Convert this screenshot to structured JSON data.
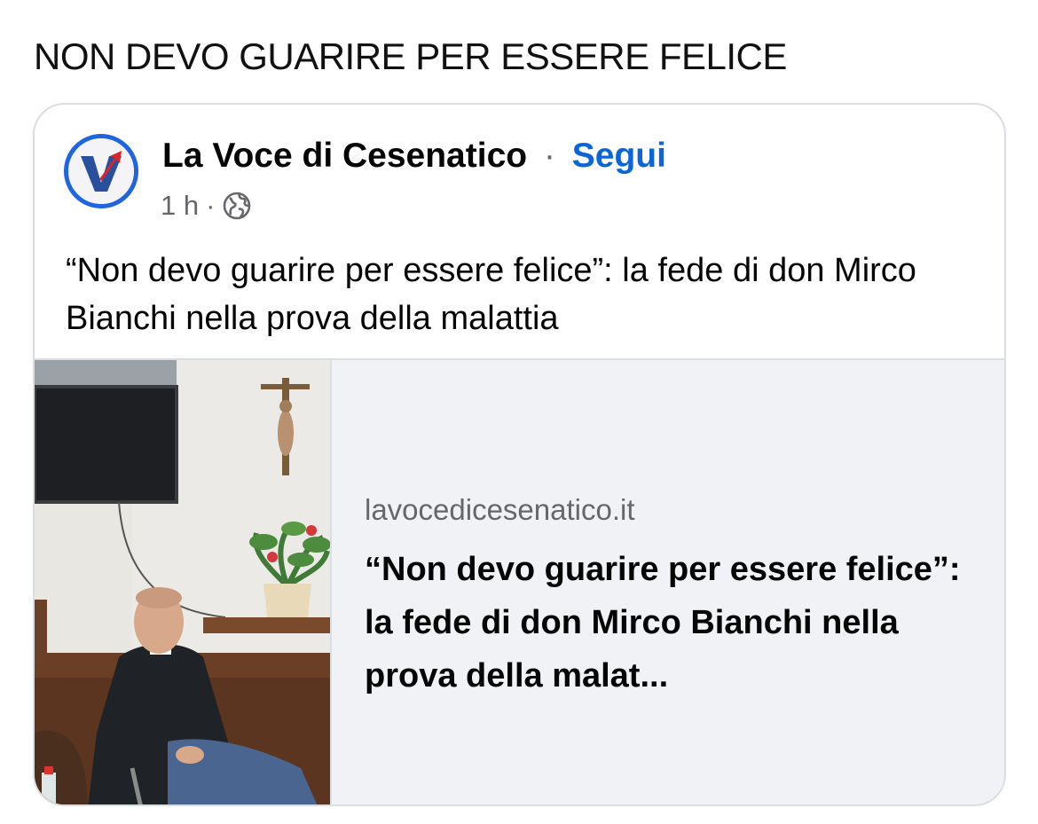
{
  "heading": "NON DEVO GUARIRE PER ESSERE FELICE",
  "post": {
    "author": "La Voce di Cesenatico",
    "separator": "·",
    "follow_label": "Segui",
    "time": "1 h",
    "meta_separator": "·",
    "audience_icon": "globe-icon",
    "text": "“Non devo guarire per essere felice”: la fede di don Mirco Bianchi nella prova della malattia"
  },
  "link_preview": {
    "domain": "lavocedicesenatico.it",
    "title": "“Non devo guarire per essere felice”: la fede di don Mirco Bianchi nella prova della malat..."
  },
  "colors": {
    "follow": "#0a66d8",
    "avatar_ring": "#1f64e0",
    "secondary_text": "#65676b",
    "preview_bg": "#f0f2f5",
    "border": "#dadde1"
  }
}
